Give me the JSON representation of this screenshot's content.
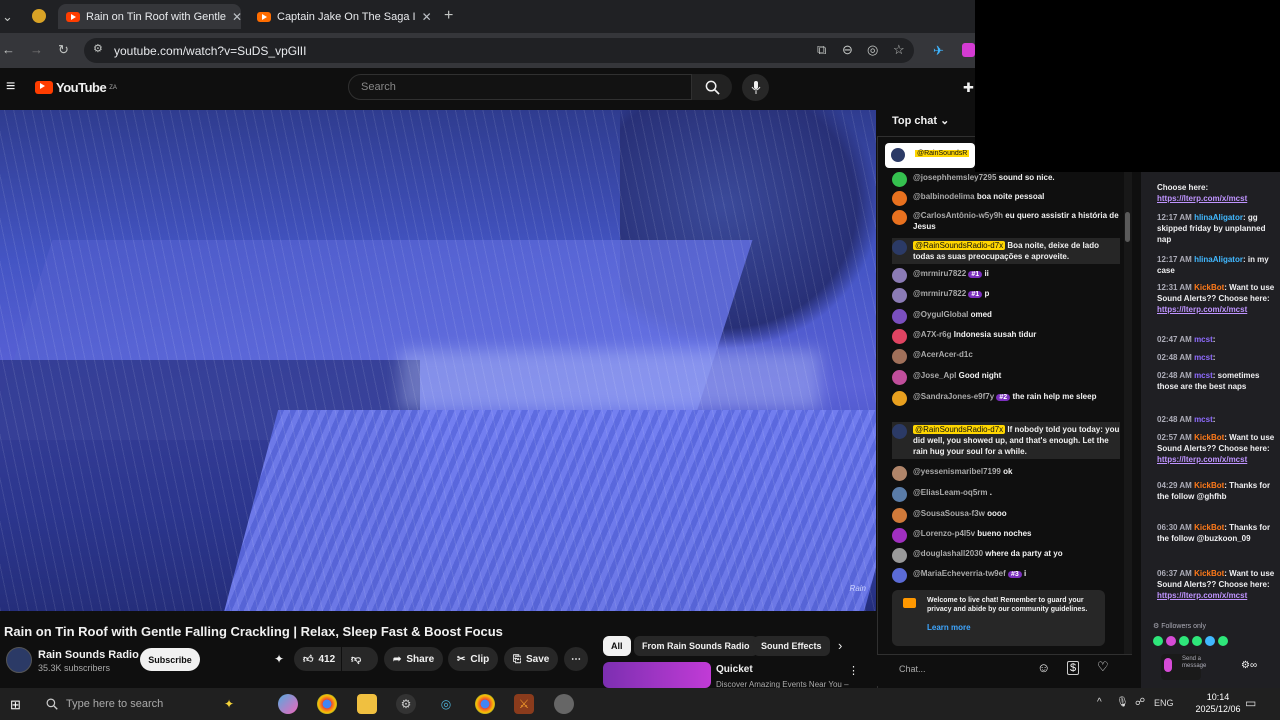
{
  "browser": {
    "tabs": [
      {
        "title": "Rain on Tin Roof with Gentle",
        "active": true
      },
      {
        "title": "Captain Jake On The Saga I",
        "active": false
      }
    ],
    "url": "youtube.com/watch?v=SuDS_vpGlII"
  },
  "youtube": {
    "logo": "YouTube",
    "logo_sup": "ZA",
    "search_placeholder": "Search"
  },
  "video": {
    "watermark": "Rain",
    "title": "Rain on Tin Roof with Gentle Falling Crackling | Relax, Sleep Fast & Boost Focus",
    "channel": "Rain Sounds Radio",
    "subscribers": "35.3K subscribers",
    "subscribe_label": "Subscribe",
    "likes": "412",
    "share_label": "Share",
    "clip_label": "Clip",
    "save_label": "Save"
  },
  "filter_chips": [
    "All",
    "From Rain Sounds Radio",
    "Sound Effects"
  ],
  "recommendation": {
    "title": "Quicket",
    "description": "Discover Amazing Events Near You –"
  },
  "live_chat": {
    "header": "Top chat",
    "pinned_author": "@RainSoundsR",
    "messages": [
      {
        "author": "@josephhemsley7295",
        "text": "sound so nice.",
        "avatar_color": "#35c14f"
      },
      {
        "author": "@balbinodelima",
        "text": "boa noite pessoal",
        "avatar_color": "#e8711f"
      },
      {
        "author": "@CarlosAntônio-w5y9h",
        "text": "eu quero assistir a história de Jesus",
        "avatar_color": "#e8711f"
      },
      {
        "author": "@RainSoundsRadio-d7x",
        "text": "Boa noite, deixe de lado todas as suas preocupações e aproveite.",
        "owner": true,
        "avatar_color": "#2b3a66"
      },
      {
        "author": "@mrmiru7822",
        "badge": "#1",
        "text": "ii",
        "avatar_color": "#8b7bb5"
      },
      {
        "author": "@mrmiru7822",
        "badge": "#1",
        "text": "p",
        "avatar_color": "#8b7bb5"
      },
      {
        "author": "@OygulGlobal",
        "text": "omed",
        "avatar_color": "#7a4fbf"
      },
      {
        "author": "@A7X-r6g",
        "text": "Indonesia susah tidur",
        "avatar_color": "#e04462"
      },
      {
        "author": "@AcerAcer-d1c",
        "text": "",
        "avatar_color": "#a0705a"
      },
      {
        "author": "@Jose_Apl",
        "text": "Good night",
        "avatar_color": "#c04e9b"
      },
      {
        "author": "@SandraJones-e9f7y",
        "badge": "#2",
        "text": "the rain help me sleep",
        "avatar_color": "#e8a01f"
      },
      {
        "author": "@RainSoundsRadio-d7x",
        "text": "If nobody told you today: you did well, you showed up, and that's enough. Let the rain hug your soul for a while.",
        "owner": true,
        "avatar_color": "#2b3a66"
      },
      {
        "author": "@yessenismaribel7199",
        "text": "ok",
        "avatar_color": "#b0856a"
      },
      {
        "author": "@EliasLeam-oq5rm",
        "text": ".",
        "avatar_color": "#5a7ca8"
      },
      {
        "author": "@SousaSousa-f3w",
        "text": "oooo",
        "avatar_color": "#d07a3a"
      },
      {
        "author": "@Lorenzo-p4l5v",
        "text": "bueno noches",
        "avatar_color": "#a02fc0"
      },
      {
        "author": "@douglashall2030",
        "text": "where da party at yo",
        "avatar_color": "#999999"
      },
      {
        "author": "@MariaEcheverria-tw9ef",
        "badge": "#3",
        "text": "i",
        "avatar_color": "#5b6bd6"
      }
    ],
    "welcome_text": "Welcome to live chat! Remember to guard your privacy and abide by our community guidelines.",
    "learn_more": "Learn more",
    "input_placeholder": "Chat..."
  },
  "twitch_chat": {
    "lines": [
      {
        "time": "",
        "user": "",
        "text": "Choose here:",
        "link": "https://lterp.com/x/mcst"
      },
      {
        "time": "12:17 AM",
        "user": "hlinaAligator",
        "user_class": "u-hl",
        "text": ": gg skipped friday by unplanned nap"
      },
      {
        "time": "12:17 AM",
        "user": "hlinaAligator",
        "user_class": "u-hl",
        "text": ": in my case"
      },
      {
        "time": "12:31 AM",
        "user": "KickBot",
        "user_class": "u-kick",
        "text": ": Want to use Sound Alerts?? Choose here:",
        "link": "https://lterp.com/x/mcst"
      },
      {
        "time": "02:47 AM",
        "user": "mcst",
        "user_class": "u-mc",
        "text": ":"
      },
      {
        "time": "02:48 AM",
        "user": "mcst",
        "user_class": "u-mc",
        "text": ":"
      },
      {
        "time": "02:48 AM",
        "user": "mcst",
        "user_class": "u-mc",
        "text": ": sometimes those are the best naps"
      },
      {
        "time": "02:48 AM",
        "user": "mcst",
        "user_class": "u-mc",
        "text": ":"
      },
      {
        "time": "02:57 AM",
        "user": "KickBot",
        "user_class": "u-kick",
        "text": ": Want to use Sound Alerts?? Choose here:",
        "link": "https://lterp.com/x/mcst"
      },
      {
        "time": "04:29 AM",
        "user": "KickBot",
        "user_class": "u-kick",
        "text": ": Thanks for the follow @ghfhb"
      },
      {
        "time": "06:30 AM",
        "user": "KickBot",
        "user_class": "u-kick",
        "text": ": Thanks for the follow @buzkoon_09"
      },
      {
        "time": "06:37 AM",
        "user": "KickBot",
        "user_class": "u-kick",
        "text": ": Want to use Sound Alerts?? Choose here:",
        "link": "https://lterp.com/x/mcst"
      }
    ],
    "followers_only": "Followers only",
    "send_label": "Send a message"
  },
  "taskbar": {
    "search_placeholder": "Type here to search",
    "language": "ENG",
    "time": "10:14",
    "date": "2025/12/06"
  }
}
